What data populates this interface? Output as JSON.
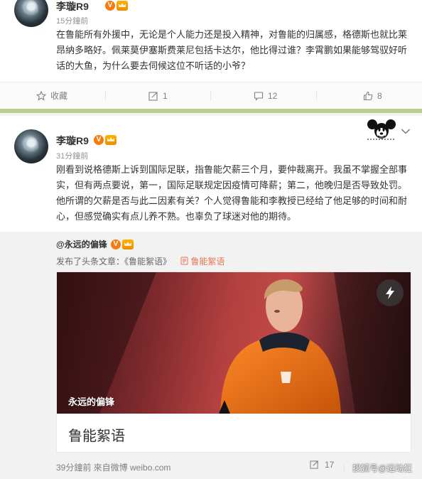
{
  "post1": {
    "username": "李璇R9",
    "badge_v": "V",
    "timestamp": "15分鐘前",
    "text": "在鲁能所有外援中，无论是个人能力还是投入精神，对鲁能的归属感，格德斯也就比莱昂纳多略好。佩莱莫伊塞斯费莱尼包括卡达尔，他比得过谁？李霄鹏如果能够驾驭好听话的大鱼，为什么要去伺候这位不听话的小爷？",
    "actions": {
      "favorite": "收藏",
      "forward": "1",
      "comment": "12",
      "like": "8"
    }
  },
  "post2": {
    "username": "李璇R9",
    "badge_v": "V",
    "timestamp": "31分鐘前",
    "text": "刚看到说格德斯上诉到国际足联，指鲁能欠薪三个月，要仲裁离开。我虽不掌握全部事实，但有两点要说，第一，国际足联规定因疫情可降薪；第二，他晚归是否导致处罚。他所谓的欠薪是否与此二因素有关？个人觉得鲁能和李教授已经给了他足够的时间和耐心，但感觉确实有点儿养不熟。也辜负了球迷对他的期待。",
    "repost": {
      "author": "@永远的偏锋",
      "badge_v": "V",
      "published_prefix": "发布了头条文章：",
      "article_quote": "《鲁能絮语》",
      "article_link": "鲁能絮语",
      "card": {
        "image_caption": "永远的偏锋",
        "title": "鲁能絮语"
      },
      "footer": "39分鐘前  來自微博 weibo.com",
      "forward_count": "17"
    }
  },
  "watermark": "搜狐号@运动狂",
  "colors": {
    "link": "#eb7350",
    "vip_orange": "#f77b0e",
    "separator_green": "#b8d08f"
  },
  "icons": [
    "star-icon",
    "forward-icon",
    "comment-icon",
    "like-icon",
    "chevron-down-icon",
    "lightning-icon",
    "mickey-icon",
    "article-link-icon"
  ]
}
